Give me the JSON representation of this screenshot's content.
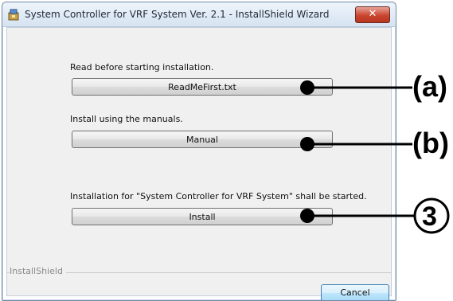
{
  "window": {
    "title": "System Controller for VRF System Ver. 2.1 - InstallShield Wizard",
    "close_label": "✕"
  },
  "sections": {
    "readme": {
      "label": "Read before starting installation.",
      "button": "ReadMeFirst.txt"
    },
    "manual": {
      "label": "Install using the manuals.",
      "button": "Manual"
    },
    "install": {
      "label": "Installation for \"System Controller for VRF System\" shall be started.",
      "button": "Install"
    }
  },
  "footer": {
    "brand": "InstallShield",
    "cancel": "Cancel"
  },
  "annotations": {
    "a": "(a)",
    "b": "(b)",
    "step": "3"
  },
  "colors": {
    "title_bar": "#d6e3f1",
    "close_button": "#c9452f",
    "dialog_bg": "#f0f0f0",
    "callout": "#000000"
  }
}
